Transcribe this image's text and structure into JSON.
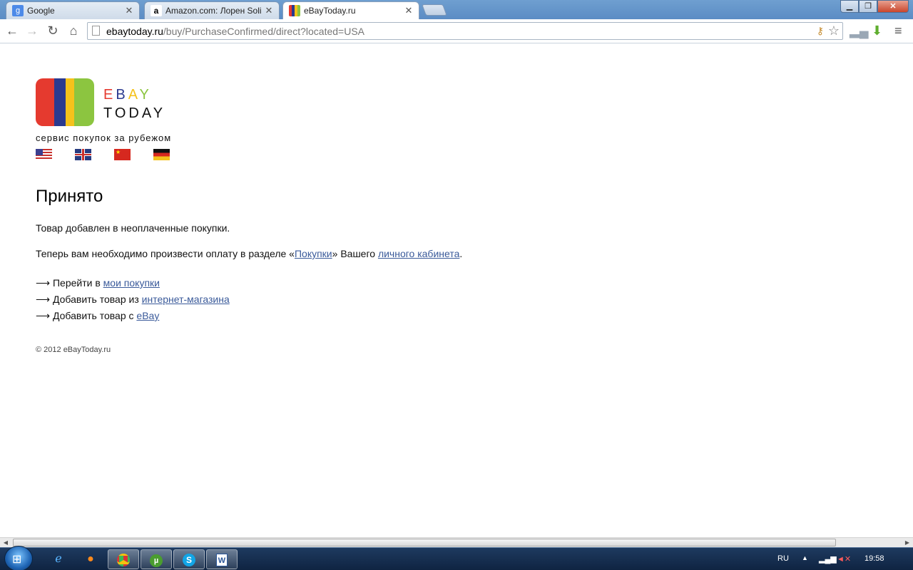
{
  "browser": {
    "tabs": [
      {
        "title": "Google",
        "favicon": "google-favicon",
        "active": false
      },
      {
        "title": "Amazon.com: Лорен Soli",
        "favicon": "amazon-favicon",
        "active": false
      },
      {
        "title": "eBayToday.ru",
        "favicon": "ebaytoday-favicon",
        "active": true
      }
    ],
    "url_host": "ebaytoday.ru",
    "url_path": "/buy/PurchaseConfirmed/direct?located=USA"
  },
  "page": {
    "logo": {
      "line1": "EBAY",
      "line2": "TODAY",
      "colors": [
        "#e53a2f",
        "#2b3a8f",
        "#f5c21b",
        "#8cc540"
      ]
    },
    "tagline": "сервис покупок за рубежом",
    "flags": [
      "us-flag",
      "uk-flag",
      "china-flag",
      "germany-flag"
    ],
    "heading": "Принято",
    "message1": "Товар добавлен в неоплаченные покупки.",
    "message2": {
      "before": "Теперь вам необходимо произвести оплату в разделе «",
      "link1": "Покупки",
      "middle": "» Вашего ",
      "link2": "личного кабинета",
      "after": "."
    },
    "actions": [
      {
        "arrow": "⟶",
        "text": " Перейти в ",
        "link": "мои покупки"
      },
      {
        "arrow": "⟶",
        "text": " Добавить товар из ",
        "link": "интернет-магазина"
      },
      {
        "arrow": "⟶",
        "text": " Добавить товар с ",
        "link": "eBay"
      }
    ],
    "copyright": "© 2012 eBayToday.ru"
  },
  "taskbar": {
    "apps": [
      "internet-explorer-icon",
      "firefox-icon",
      "chrome-icon",
      "utorrent-icon",
      "skype-icon",
      "word-icon"
    ],
    "language": "RU",
    "time": "19:58"
  }
}
